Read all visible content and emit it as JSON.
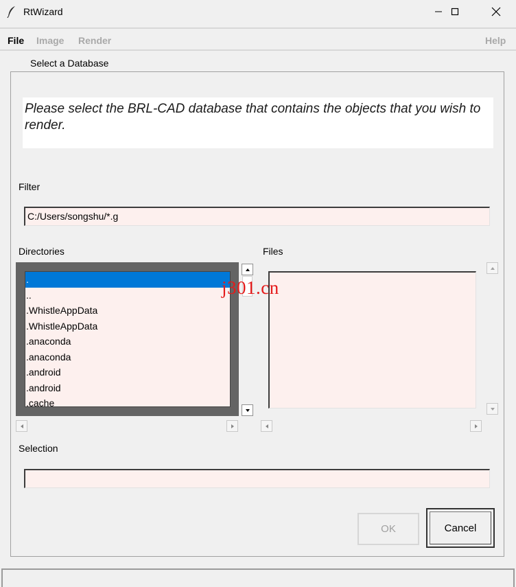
{
  "window": {
    "title": "RtWizard",
    "controls": [
      "minimize-icon",
      "maximize-icon",
      "close-icon"
    ]
  },
  "menu": {
    "items": [
      {
        "label": "File",
        "enabled": true
      },
      {
        "label": "Image",
        "enabled": false
      },
      {
        "label": "Render",
        "enabled": false
      },
      {
        "label": "Help",
        "enabled": false
      }
    ]
  },
  "page": {
    "step_title": "Select a Database",
    "instructions": "Please select the BRL-CAD database that contains the objects that you wish to render."
  },
  "filter": {
    "label": "Filter",
    "value": "C:/Users/songshu/*.g"
  },
  "directories": {
    "label": "Directories",
    "items": [
      ".",
      "..",
      ".WhistleAppData",
      ".WhistleAppData",
      ".anaconda",
      ".anaconda",
      ".android",
      ".android",
      ".cache"
    ],
    "selected_index": 0
  },
  "files": {
    "label": "Files",
    "items": []
  },
  "selection": {
    "label": "Selection",
    "value": ""
  },
  "buttons": {
    "ok": "OK",
    "cancel": "Cancel"
  },
  "watermark": "j301.cn",
  "colors": {
    "selection_highlight": "#0078d7",
    "entry_background": "#fdf0ee",
    "watermark": "#e41b1b",
    "disabled_text": "#a9a9a9"
  }
}
